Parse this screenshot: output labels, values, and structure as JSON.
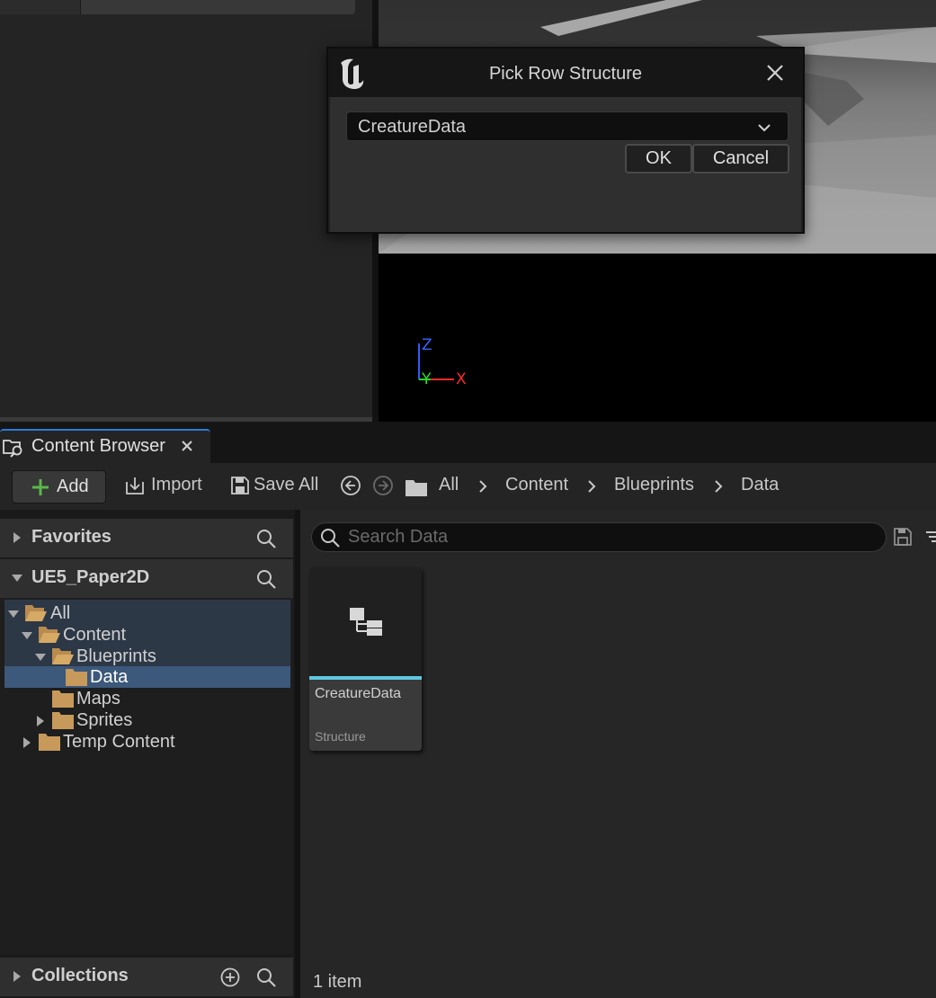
{
  "dialog": {
    "title": "Pick Row Structure",
    "selected_struct": "CreatureData",
    "ok_label": "OK",
    "cancel_label": "Cancel"
  },
  "viewport": {
    "axis": {
      "z": "Z",
      "y": "Y",
      "x": "X"
    }
  },
  "content_browser": {
    "tab_title": "Content Browser",
    "toolbar": {
      "add_label": "Add",
      "import_label": "Import",
      "save_all_label": "Save All"
    },
    "breadcrumb": [
      "All",
      "Content",
      "Blueprints",
      "Data"
    ],
    "sidebar": {
      "favorites_label": "Favorites",
      "project_label": "UE5_Paper2D",
      "collections_label": "Collections",
      "tree": [
        {
          "label": "All",
          "depth": 0,
          "expanded": true
        },
        {
          "label": "Content",
          "depth": 1,
          "expanded": true
        },
        {
          "label": "Blueprints",
          "depth": 2,
          "expanded": true
        },
        {
          "label": "Data",
          "depth": 3,
          "selected": true
        },
        {
          "label": "Maps",
          "depth": 2
        },
        {
          "label": "Sprites",
          "depth": 2,
          "expanded": false
        },
        {
          "label": "Temp Content",
          "depth": 1,
          "expanded": false
        }
      ]
    },
    "search": {
      "placeholder": "Search Data"
    },
    "assets": [
      {
        "name": "CreatureData",
        "type": "Structure",
        "type_color": "#5ec8e0"
      }
    ],
    "item_count": "1 item"
  },
  "colors": {
    "accent_tab": "#2b7ad8",
    "selection": "#3c587a",
    "add_green": "#5ab84a",
    "folder": "#c79a5b"
  }
}
